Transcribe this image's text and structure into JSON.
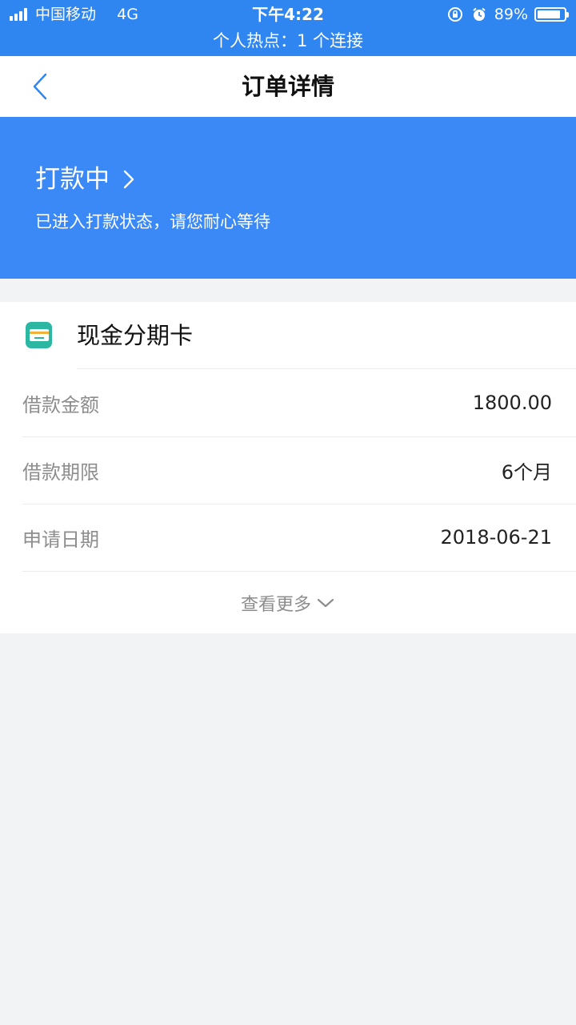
{
  "status_bar": {
    "carrier": "中国移动",
    "network": "4G",
    "time": "下午4:22",
    "battery_text": "89%",
    "battery_level": 0.89,
    "hotspot_text": "个人热点：1 个连接",
    "icons": [
      "signal-icon",
      "rotation-lock-icon",
      "alarm-icon",
      "battery-icon"
    ]
  },
  "nav": {
    "title": "订单详情",
    "back_icon": "chevron-left-icon"
  },
  "banner": {
    "status": "打款中",
    "message": "已进入打款状态，请您耐心等待",
    "color": "#3a89f7"
  },
  "card": {
    "title": "现金分期卡",
    "icon": "card-icon",
    "rows": [
      {
        "label": "借款金额",
        "value": "1800.00"
      },
      {
        "label": "借款期限",
        "value": "6个月"
      },
      {
        "label": "申请日期",
        "value": "2018-06-21"
      }
    ],
    "more_label": "查看更多"
  },
  "colors": {
    "status_bar": "#2f86f0",
    "accent": "#3a89f7",
    "background": "#f2f3f5"
  }
}
